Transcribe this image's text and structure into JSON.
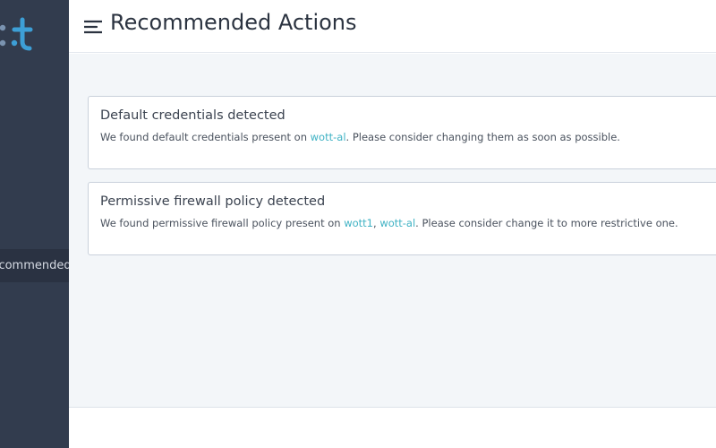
{
  "sidebar": {
    "logo_icon": "wott-logo-icon",
    "active_item": {
      "label": "Recommended Actions"
    },
    "colors": {
      "background": "#323c4e",
      "active": "#2a3242",
      "logo_dark": "#6f8aa8",
      "logo_accent": "#3d9fd6"
    }
  },
  "header": {
    "menu_icon": "hamburger-menu-icon",
    "title": "Recommended Actions"
  },
  "actions": [
    {
      "title": "Default credentials detected",
      "text_before": "We found default credentials present on ",
      "links": [
        {
          "label": "wott-al"
        }
      ],
      "text_after": ". Please consider changing them as soon as possible."
    },
    {
      "title": "Permissive firewall policy detected",
      "text_before": "We found permissive firewall policy present on ",
      "links": [
        {
          "label": "wott1"
        },
        {
          "label": "wott-al"
        }
      ],
      "separator": ", ",
      "text_after": ". Please consider change it to more restrictive one."
    }
  ],
  "colors": {
    "link": "#3fb2c4",
    "page_background": "#f3f6f9",
    "card_border": "#c9d1db"
  }
}
